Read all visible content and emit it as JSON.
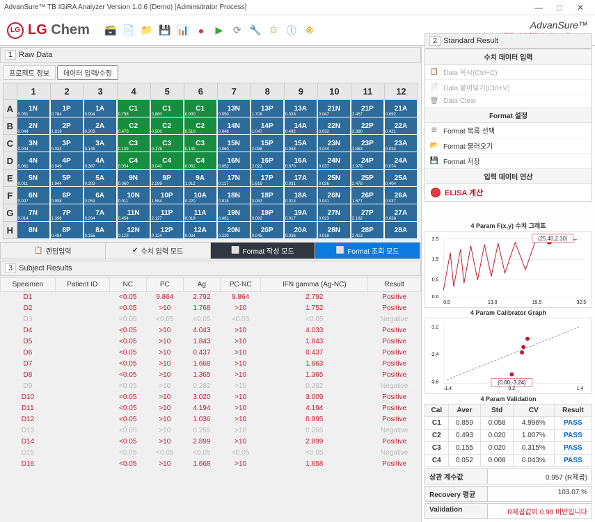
{
  "window": {
    "title": "AdvanSure™ TB IGiRA Analyzer Version 1.0.6 (Demo) [Adminsitrator Process]"
  },
  "brand": {
    "line1": "AdvanSure™",
    "line2": "TB IGiRA Analyzer"
  },
  "sections": {
    "raw": "Raw Data",
    "std": "Standard Result",
    "subj": "Subject Results"
  },
  "tabs": {
    "t0": "Raw Data",
    "t1": "프로젝트 정보",
    "t2": "데이터 입력/수정"
  },
  "cols": [
    "1",
    "2",
    "3",
    "4",
    "5",
    "6",
    "7",
    "8",
    "9",
    "10",
    "11",
    "12"
  ],
  "rows": [
    "A",
    "B",
    "C",
    "D",
    "E",
    "F",
    "G",
    "H"
  ],
  "plate": [
    [
      {
        "l": "1N",
        "v": "0.051",
        "c": "b"
      },
      {
        "l": "1P",
        "v": "0.784",
        "c": "b"
      },
      {
        "l": "1A",
        "v": "0.904",
        "c": "b"
      },
      {
        "l": "C1",
        "v": "0.798",
        "c": "g"
      },
      {
        "l": "C1",
        "v": "0.880",
        "c": "g"
      },
      {
        "l": "C1",
        "v": "0.900",
        "c": "g"
      },
      {
        "l": "13N",
        "v": "0.050",
        "c": "b"
      },
      {
        "l": "13P",
        "v": "1.708",
        "c": "b"
      },
      {
        "l": "13A",
        "v": "0.038",
        "c": "b"
      },
      {
        "l": "21N",
        "v": "0.047",
        "c": "b"
      },
      {
        "l": "21P",
        "v": "2.457",
        "c": "b"
      },
      {
        "l": "21A",
        "v": "0.692",
        "c": "b"
      }
    ],
    [
      {
        "l": "2N",
        "v": "0.044",
        "c": "b"
      },
      {
        "l": "2P",
        "v": "1.818",
        "c": "b"
      },
      {
        "l": "2A",
        "v": "0.203",
        "c": "b"
      },
      {
        "l": "C2",
        "v": "0.470",
        "c": "g"
      },
      {
        "l": "C2",
        "v": "0.500",
        "c": "g"
      },
      {
        "l": "C2",
        "v": "0.510",
        "c": "g"
      },
      {
        "l": "14N",
        "v": "0.046",
        "c": "b"
      },
      {
        "l": "14P",
        "v": "1.047",
        "c": "b"
      },
      {
        "l": "14A",
        "v": "0.492",
        "c": "b"
      },
      {
        "l": "22N",
        "v": "0.032",
        "c": "b"
      },
      {
        "l": "22P",
        "v": "2.380",
        "c": "b"
      },
      {
        "l": "22A",
        "v": "0.421",
        "c": "b"
      }
    ],
    [
      {
        "l": "3N",
        "v": "0.044",
        "c": "b"
      },
      {
        "l": "3P",
        "v": "0.034",
        "c": "b"
      },
      {
        "l": "3A",
        "v": "0.149",
        "c": "b"
      },
      {
        "l": "C3",
        "v": "0.139",
        "c": "g"
      },
      {
        "l": "C3",
        "v": "0.178",
        "c": "g"
      },
      {
        "l": "C3",
        "v": "0.149",
        "c": "g"
      },
      {
        "l": "15N",
        "v": "0.060",
        "c": "b"
      },
      {
        "l": "15P",
        "v": "2.098",
        "c": "b"
      },
      {
        "l": "15A",
        "v": "0.048",
        "c": "b"
      },
      {
        "l": "23N",
        "v": "0.044",
        "c": "b"
      },
      {
        "l": "23P",
        "v": "1.883",
        "c": "b"
      },
      {
        "l": "23A",
        "v": "0.034",
        "c": "b"
      }
    ],
    [
      {
        "l": "4N",
        "v": "0.061",
        "c": "b"
      },
      {
        "l": "4P",
        "v": "0.949",
        "c": "b"
      },
      {
        "l": "4A",
        "v": "0.387",
        "c": "b"
      },
      {
        "l": "C4",
        "v": "0.054",
        "c": "g"
      },
      {
        "l": "C4",
        "v": "0.040",
        "c": "g"
      },
      {
        "l": "C4",
        "v": "0.061",
        "c": "g"
      },
      {
        "l": "16N",
        "v": "0.052",
        "c": "b"
      },
      {
        "l": "16P",
        "v": "2.022",
        "c": "b"
      },
      {
        "l": "16A",
        "v": "0.070",
        "c": "b"
      },
      {
        "l": "24N",
        "v": "0.037",
        "c": "b"
      },
      {
        "l": "24P",
        "v": "1.978",
        "c": "b"
      },
      {
        "l": "24A",
        "v": "0.074",
        "c": "b"
      }
    ],
    [
      {
        "l": "5N",
        "v": "0.011",
        "c": "b"
      },
      {
        "l": "5P",
        "v": "1.944",
        "c": "b"
      },
      {
        "l": "5A",
        "v": "0.203",
        "c": "b"
      },
      {
        "l": "9N",
        "v": "0.060",
        "c": "b"
      },
      {
        "l": "9P",
        "v": "2.289",
        "c": "b"
      },
      {
        "l": "9A",
        "v": "1.912",
        "c": "b"
      },
      {
        "l": "17N",
        "v": "0.117",
        "c": "b"
      },
      {
        "l": "17P",
        "v": "1.619",
        "c": "b"
      },
      {
        "l": "17A",
        "v": "0.031",
        "c": "b"
      },
      {
        "l": "25N",
        "v": "0.026",
        "c": "b"
      },
      {
        "l": "25P",
        "v": "2.478",
        "c": "b"
      },
      {
        "l": "25A",
        "v": "0.404",
        "c": "b"
      }
    ],
    [
      {
        "l": "6N",
        "v": "0.007",
        "c": "b"
      },
      {
        "l": "6P",
        "v": "0.998",
        "c": "b"
      },
      {
        "l": "6A",
        "v": "0.053",
        "c": "b"
      },
      {
        "l": "10N",
        "v": "0.011",
        "c": "b"
      },
      {
        "l": "10P",
        "v": "1.584",
        "c": "b"
      },
      {
        "l": "10A",
        "v": "0.220",
        "c": "b"
      },
      {
        "l": "18N",
        "v": "0.818",
        "c": "b"
      },
      {
        "l": "18P",
        "v": "0.083",
        "c": "b"
      },
      {
        "l": "18A",
        "v": "0.013",
        "c": "b"
      },
      {
        "l": "26N",
        "v": "0.041",
        "c": "b"
      },
      {
        "l": "26P",
        "v": "1.677",
        "c": "b"
      },
      {
        "l": "26A",
        "v": "0.037",
        "c": "b"
      }
    ],
    [
      {
        "l": "7N",
        "v": "0.014",
        "c": "b"
      },
      {
        "l": "7P",
        "v": "1.396",
        "c": "b"
      },
      {
        "l": "7A",
        "v": "0.204",
        "c": "b"
      },
      {
        "l": "11N",
        "v": "0.454",
        "c": "b"
      },
      {
        "l": "11P",
        "v": "2.127",
        "c": "b"
      },
      {
        "l": "11A",
        "v": "0.018",
        "c": "b"
      },
      {
        "l": "19N",
        "v": "0.461",
        "c": "b"
      },
      {
        "l": "19P",
        "v": "0.092",
        "c": "b"
      },
      {
        "l": "19A",
        "v": "0.017",
        "c": "b"
      },
      {
        "l": "27N",
        "v": "0.023",
        "c": "b"
      },
      {
        "l": "27P",
        "v": "2.182",
        "c": "b"
      },
      {
        "l": "27A",
        "v": "0.038",
        "c": "b"
      }
    ],
    [
      {
        "l": "8N",
        "v": "",
        "c": "b"
      },
      {
        "l": "8P",
        "v": "0.484",
        "c": "b"
      },
      {
        "l": "8A",
        "v": "0.155",
        "c": "b"
      },
      {
        "l": "12N",
        "v": "0.123",
        "c": "b"
      },
      {
        "l": "12P",
        "v": "0.124",
        "c": "b"
      },
      {
        "l": "12A",
        "v": "0.034",
        "c": "b"
      },
      {
        "l": "20N",
        "v": "0.230",
        "c": "b"
      },
      {
        "l": "20P",
        "v": "0.045",
        "c": "b"
      },
      {
        "l": "20A",
        "v": "0.036",
        "c": "b"
      },
      {
        "l": "28N",
        "v": "0.018",
        "c": "b"
      },
      {
        "l": "28P",
        "v": "2.413",
        "c": "b"
      },
      {
        "l": "28A",
        "v": "",
        "c": "b"
      }
    ]
  ],
  "modebar": {
    "m0": "랜덤입력",
    "m1": "수치 입력 모드",
    "m2": "Format 작성 모드",
    "m3": "Format 조회 모드"
  },
  "side": {
    "input_head": "수치 데이터 입력",
    "copy": "Data 복사(Ctrl+C)",
    "paste": "Data 붙여넣기(Ctrl+V)",
    "clear": "Data Clear",
    "format_head": "Format 설정",
    "fmt_select": "Format 목록 선택",
    "fmt_load": "Format 불러오기",
    "fmt_save": "Format 저장",
    "calc_head": "입력 데이터 연산",
    "elisa": "ELISA 계산"
  },
  "results_head": [
    "Specimen",
    "Patient ID",
    "NC",
    "PC",
    "Ag",
    "PC-NC",
    "IFN gamma (Ag-NC)",
    "Result"
  ],
  "results": [
    {
      "s": "D1",
      "nc": "<0.05",
      "pc": "9.864",
      "ag": "2.792",
      "pcnc": "9.864",
      "ifn": "2.792",
      "r": "Positive",
      "g": false
    },
    {
      "s": "D2",
      "nc": "<0.05",
      "pc": ">10",
      "ag": "1.768",
      "pcnc": ">10",
      "ifn": "1.752",
      "r": "Positive",
      "g": false
    },
    {
      "s": "D3",
      "nc": "<0.05",
      "pc": "<0.05",
      "ag": "<0.05",
      "pcnc": "<0.05",
      "ifn": "<0.05",
      "r": "Negative",
      "g": true
    },
    {
      "s": "D4",
      "nc": "<0.05",
      "pc": ">10",
      "ag": "4.043",
      "pcnc": ">10",
      "ifn": "4.033",
      "r": "Positive",
      "g": false
    },
    {
      "s": "D5",
      "nc": "<0.05",
      "pc": ">10",
      "ag": "1.843",
      "pcnc": ">10",
      "ifn": "1.843",
      "r": "Positive",
      "g": false
    },
    {
      "s": "D6",
      "nc": "<0.05",
      "pc": ">10",
      "ag": "0.437",
      "pcnc": ">10",
      "ifn": "0.437",
      "r": "Positive",
      "g": false
    },
    {
      "s": "D7",
      "nc": "<0.05",
      "pc": ">10",
      "ag": "1.668",
      "pcnc": ">10",
      "ifn": "1.663",
      "r": "Positive",
      "g": false
    },
    {
      "s": "D8",
      "nc": "<0.05",
      "pc": ">10",
      "ag": "1.365",
      "pcnc": ">10",
      "ifn": "1.365",
      "r": "Positive",
      "g": false
    },
    {
      "s": "D9",
      "nc": "<0.05",
      "pc": ">10",
      "ag": "0.282",
      "pcnc": ">10",
      "ifn": "0.282",
      "r": "Negative",
      "g": true
    },
    {
      "s": "D10",
      "nc": "<0.05",
      "pc": ">10",
      "ag": "3.020",
      "pcnc": ">10",
      "ifn": "3.009",
      "r": "Positive",
      "g": false
    },
    {
      "s": "D11",
      "nc": "<0.05",
      "pc": ">10",
      "ag": "4.194",
      "pcnc": ">10",
      "ifn": "4.194",
      "r": "Positive",
      "g": false
    },
    {
      "s": "D12",
      "nc": "<0.05",
      "pc": ">10",
      "ag": "1.036",
      "pcnc": ">10",
      "ifn": "0.995",
      "r": "Positive",
      "g": false
    },
    {
      "s": "D13",
      "nc": "<0.05",
      "pc": ">10",
      "ag": "0.255",
      "pcnc": ">10",
      "ifn": "0.255",
      "r": "Negative",
      "g": true
    },
    {
      "s": "D14",
      "nc": "<0.05",
      "pc": ">10",
      "ag": "2.899",
      "pcnc": ">10",
      "ifn": "2.899",
      "r": "Positive",
      "g": false
    },
    {
      "s": "D15",
      "nc": "<0.05",
      "pc": "<0.05",
      "ag": "<0.05",
      "pcnc": "<0.05",
      "ifn": "<0.05",
      "r": "Negative",
      "g": true
    },
    {
      "s": "D16",
      "nc": "<0.05",
      "pc": ">10",
      "ag": "1.668",
      "pcnc": ">10",
      "ifn": "1.658",
      "r": "Positive",
      "g": false
    }
  ],
  "charts": {
    "title1": "4 Param F(x,y) 수치 그래프",
    "anno1": "(25.40,2.30)",
    "title2": "4 Param Calibrator Graph",
    "anno2": "(0.00,-3.24)",
    "valid_title": "4 Param Validation"
  },
  "chart_data": [
    {
      "type": "line",
      "title": "4 Param F(x,y) 수치 그래프",
      "x": [
        0.5,
        6.5,
        13.0,
        19.5,
        26.0,
        32.5
      ],
      "ylim": [
        0.0,
        2.5
      ],
      "yticks": [
        0.0,
        0.5,
        1.0,
        1.5,
        2.0,
        2.5
      ],
      "annotation": {
        "x": 25.4,
        "y": 2.3,
        "label": "(25.40,2.30)"
      }
    },
    {
      "type": "scatter",
      "title": "4 Param Calibrator Graph",
      "xlim": [
        -1.4,
        1.4
      ],
      "ylim": [
        -3.6,
        -1.2
      ],
      "yticks": [
        -3.6,
        -3.2,
        -2.8,
        -2.4,
        -2.0,
        -1.6,
        -1.2
      ],
      "xticks": [
        -1.4,
        -1.0,
        -0.6,
        -0.2,
        0.2,
        0.6,
        1.0,
        1.4
      ],
      "annotation": {
        "x": 0.0,
        "y": -3.24,
        "label": "(0.00,-3.24)"
      }
    }
  ],
  "valid_head": [
    "Cal",
    "Aver",
    "Std",
    "CV",
    "Result"
  ],
  "valid": [
    {
      "cal": "C1",
      "aver": "0.859",
      "std": "0.058",
      "cv": "4.996%",
      "res": "PASS"
    },
    {
      "cal": "C2",
      "aver": "0.493",
      "std": "0.020",
      "cv": "1.007%",
      "res": "PASS"
    },
    {
      "cal": "C3",
      "aver": "0.155",
      "std": "0.020",
      "cv": "0.315%",
      "res": "PASS"
    },
    {
      "cal": "C4",
      "aver": "0.052",
      "std": "0.008",
      "cv": "0.043%",
      "res": "PASS"
    }
  ],
  "stats": {
    "corr_lbl": "상관 계수값",
    "corr_val": "0.957 (R제곱)",
    "rec_lbl": "Recovery 평균",
    "rec_val": "103.07 %",
    "val_lbl": "Validation",
    "val_msg": "R제곱값이 0.98 미만입니다"
  }
}
